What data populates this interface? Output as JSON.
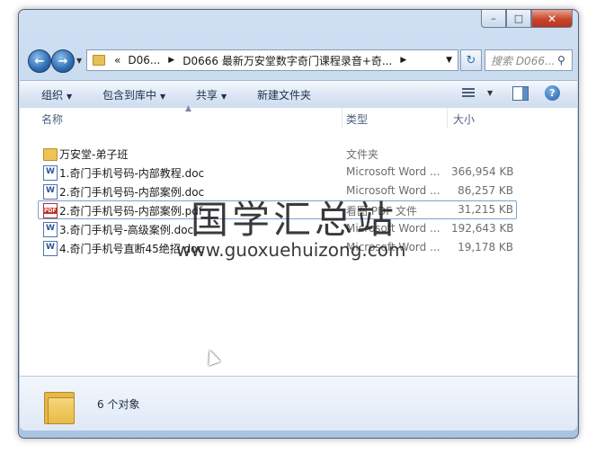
{
  "window": {
    "caption_buttons": {
      "minimize": "–",
      "maximize": "□",
      "close": "✕"
    }
  },
  "nav": {
    "back_glyph": "←",
    "forward_glyph": "→",
    "address_overflow": "«",
    "breadcrumbs": [
      "D06...",
      "D0666 最新万安堂数字奇门课程录音+奇..."
    ],
    "refresh_glyph": "↻",
    "search_placeholder": "搜索 D066...",
    "search_icon_glyph": "⚲"
  },
  "toolbar": {
    "organize": "组织",
    "include_in_library": "包含到库中",
    "share": "共享",
    "new_folder": "新建文件夹",
    "help_glyph": "?"
  },
  "columns": {
    "name": "名称",
    "type": "类型",
    "size": "大小"
  },
  "files": [
    {
      "name": "万安堂-弟子班",
      "type": "文件夹",
      "size": "",
      "icon": "folder-icon"
    },
    {
      "name": "1.奇门手机号码-内部教程.doc",
      "type": "Microsoft Word ...",
      "size": "366,954 KB",
      "icon": "word-doc-icon"
    },
    {
      "name": "2.奇门手机号码-内部案例.doc",
      "type": "Microsoft Word ...",
      "size": "86,257 KB",
      "icon": "word-doc-icon"
    },
    {
      "name": "2.奇门手机号码-内部案例.pdf",
      "type": "看图 PDF 文件",
      "size": "31,215 KB",
      "icon": "pdf-icon"
    },
    {
      "name": "3.奇门手机号-高级案例.doc",
      "type": "Microsoft Word ...",
      "size": "192,643 KB",
      "icon": "word-doc-icon"
    },
    {
      "name": "4.奇门手机号直断45绝招.doc",
      "type": "Microsoft Word ...",
      "size": "19,178 KB",
      "icon": "word-doc-icon"
    }
  ],
  "watermark": {
    "title": "国学汇总站",
    "url": "www.guoxuehuizong.com"
  },
  "status": {
    "count": "6 个对象"
  }
}
